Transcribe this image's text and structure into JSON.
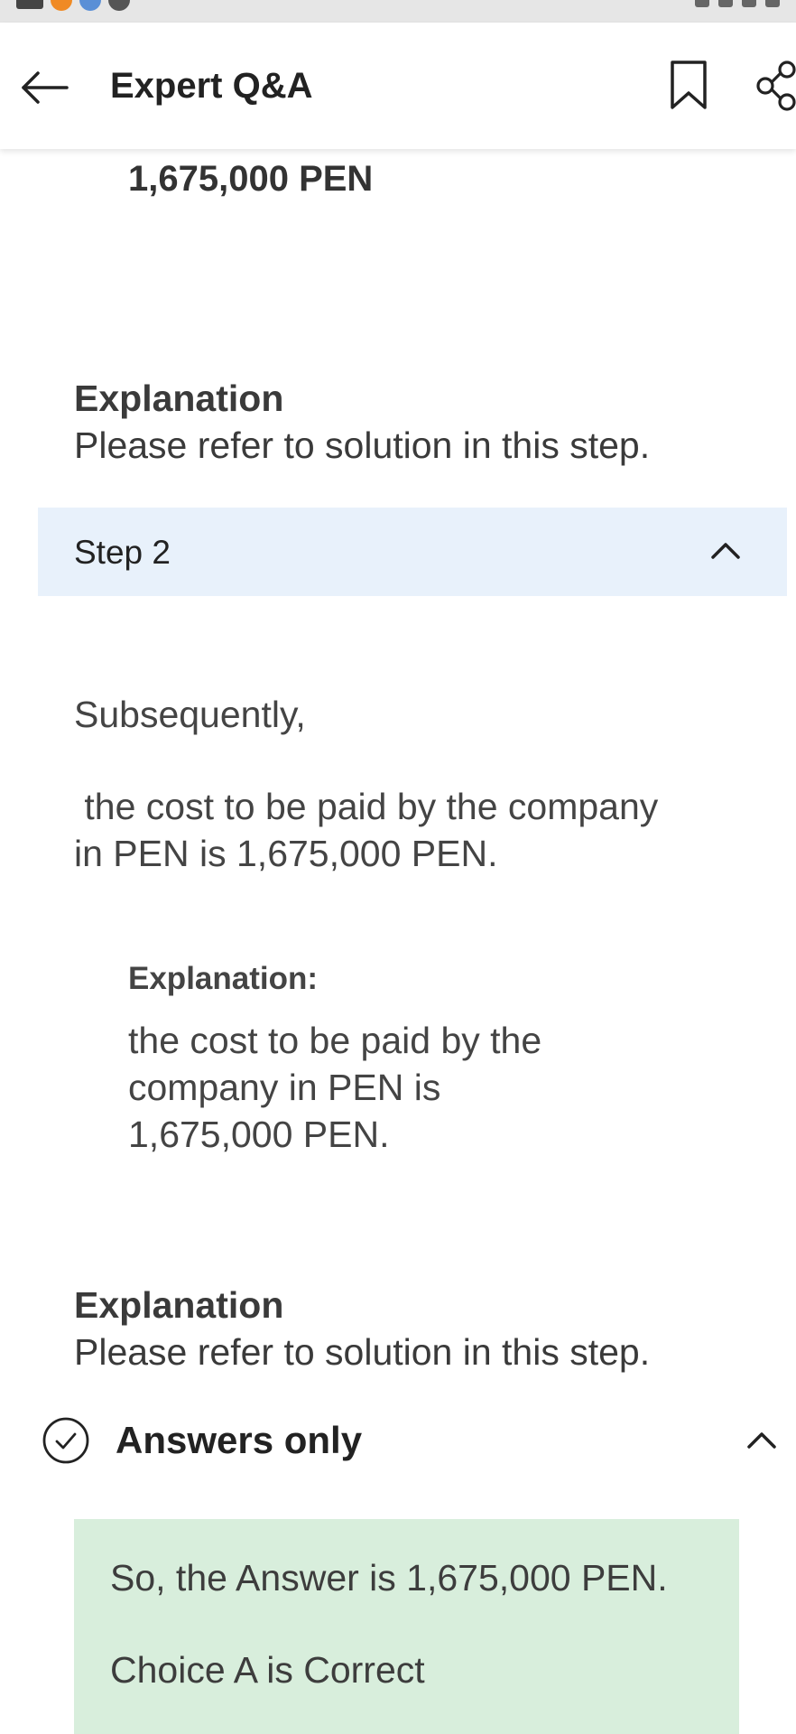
{
  "header": {
    "title": "Expert Q&A"
  },
  "icons": {
    "back": "back-arrow-icon",
    "bookmark": "bookmark-icon",
    "share": "share-icon",
    "collapse": "chevron-up-icon",
    "answers_check": "check-circle-icon"
  },
  "content": {
    "cut_answer": "1,675,000 PEN",
    "explanation1": {
      "heading": "Explanation",
      "body": "Please refer to solution in this step."
    },
    "step2": {
      "label": "Step 2",
      "intro": "Subsequently,",
      "line1": " the cost to be paid by the company",
      "line2": "in PEN is 1,675,000 PEN.",
      "sub_heading": "Explanation:",
      "sub_line1": "the cost to be paid by the",
      "sub_line2": "company in PEN is",
      "sub_line3": "1,675,000 PEN."
    },
    "explanation2": {
      "heading": "Explanation",
      "body": "Please refer to solution in this step."
    }
  },
  "answers": {
    "label": "Answers only",
    "line1": "So, the Answer is 1,675,000 PEN.",
    "line2": "Choice A is Correct"
  },
  "colors": {
    "step_bar_bg": "#e8f1fb",
    "answer_box_bg": "#d8eedc",
    "status_bar_bg": "#e6e6e6"
  }
}
